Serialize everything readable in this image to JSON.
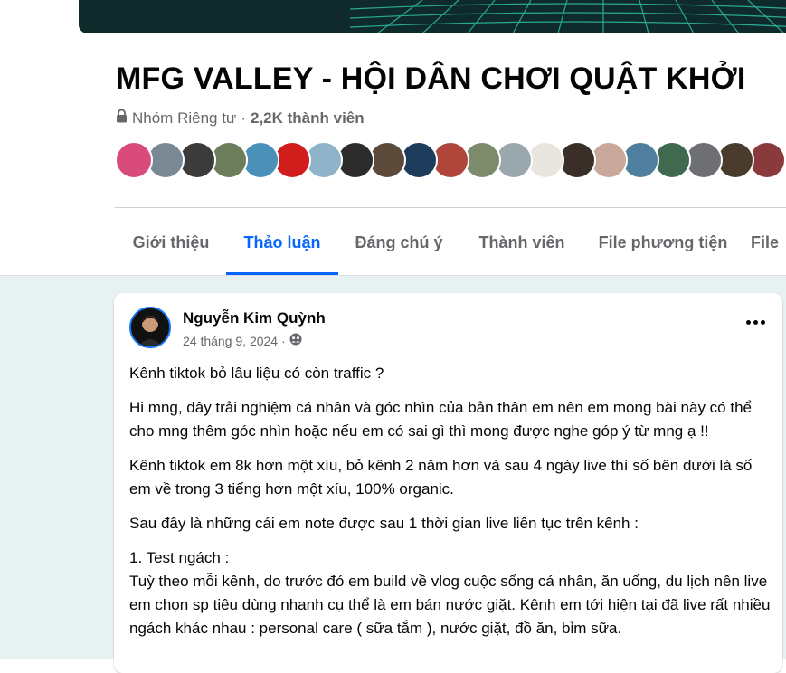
{
  "group": {
    "title": "MFG VALLEY - HỘI DÂN CHƠI QUẬT KHỞI",
    "privacy": "Nhóm Riêng tư",
    "separator": "·",
    "member_count": "2,2K thành viên"
  },
  "member_avatars": [
    {
      "color": "#d94b7a"
    },
    {
      "color": "#7a8894"
    },
    {
      "color": "#3b3b3b"
    },
    {
      "color": "#6b7d5a"
    },
    {
      "color": "#4a90b8"
    },
    {
      "color": "#d21d1d"
    },
    {
      "color": "#8fb3c9"
    },
    {
      "color": "#2c2c2c"
    },
    {
      "color": "#5c4a3a"
    },
    {
      "color": "#1d3b5a"
    },
    {
      "color": "#b0453c"
    },
    {
      "color": "#7e8b6a"
    },
    {
      "color": "#9aa7ad"
    },
    {
      "color": "#e9e6df"
    },
    {
      "color": "#3a2e28"
    },
    {
      "color": "#c9a79a"
    },
    {
      "color": "#4f7f9e"
    },
    {
      "color": "#3f6a4f"
    },
    {
      "color": "#6d6f72"
    },
    {
      "color": "#4a3b2c"
    },
    {
      "color": "#8a3a3a"
    }
  ],
  "tabs": [
    {
      "label": "Giới thiệu",
      "active": false
    },
    {
      "label": "Thảo luận",
      "active": true
    },
    {
      "label": "Đáng chú ý",
      "active": false
    },
    {
      "label": "Thành viên",
      "active": false
    },
    {
      "label": "File phương tiện",
      "active": false
    },
    {
      "label": "File",
      "active": false
    }
  ],
  "post": {
    "author": "Nguyễn Kim Quỳnh",
    "date": "24 tháng 9, 2024",
    "separator": "·",
    "audience_icon": "group-icon",
    "paragraphs": [
      "Kênh tiktok bỏ lâu liệu có còn traffic ?",
      "Hi mng, đây trải nghiệm cá nhân và góc nhìn của bản thân em nên em mong bài này có thể cho mng thêm góc nhìn hoặc nếu em có sai gì thì mong được nghe góp ý từ mng ạ !!",
      "Kênh tiktok em 8k hơn một xíu, bỏ kênh 2 năm hơn và sau 4 ngày live thì số bên dưới là số em về trong 3 tiếng hơn một xíu, 100% organic.",
      "Sau đây là những cái em note được sau 1 thời gian live liên tục trên kênh :"
    ],
    "section_heading": "1. Test ngách :",
    "section_text": "Tuỳ theo mỗi kênh, do trước đó em build về vlog cuộc sống cá nhân, ăn uống, du lịch nên live em chọn sp tiêu dùng nhanh cụ thể là em bán nước giặt. Kênh em tới hiện tại đã live rất nhiều ngách khác nhau : personal care ( sữa tắm ), nước giặt, đồ ăn, bỉm sữa."
  },
  "colors": {
    "accent": "#0866ff",
    "muted_text": "#65676b",
    "feed_background": "#e8f1f2",
    "banner": "#0e2a2a"
  }
}
